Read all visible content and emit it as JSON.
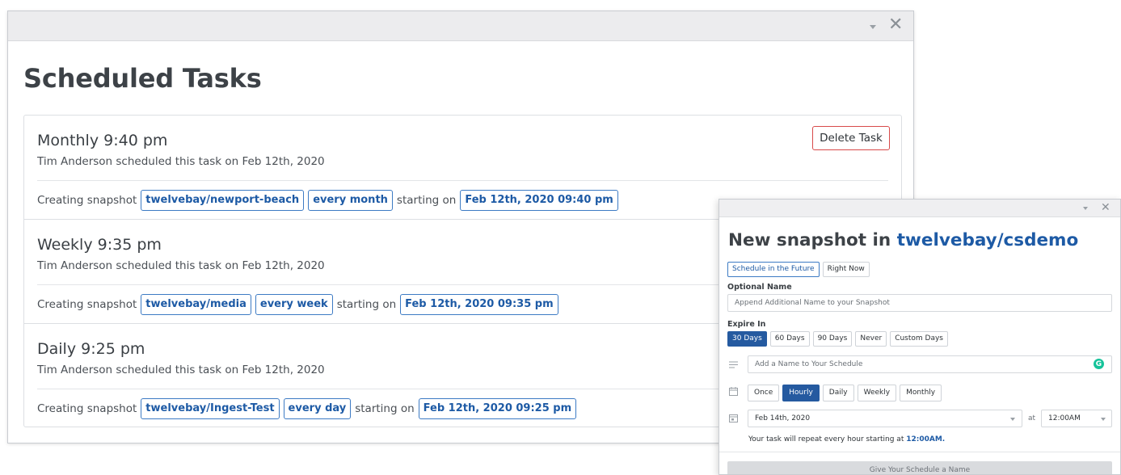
{
  "main_window": {
    "title": "Scheduled Tasks",
    "close_label": "✕",
    "delete_label": "Delete Task",
    "tasks": [
      {
        "title": "Monthly 9:40 pm",
        "scheduled_by": "Tim Anderson scheduled this task on Feb 12th, 2020",
        "prefix": "Creating snapshot",
        "repo": "twelvebay/newport-beach",
        "frequency": "every month",
        "starting_text": "starting on",
        "start": "Feb 12th, 2020 09:40 pm"
      },
      {
        "title": "Weekly 9:35 pm",
        "scheduled_by": "Tim Anderson scheduled this task on Feb 12th, 2020",
        "prefix": "Creating snapshot",
        "repo": "twelvebay/media",
        "frequency": "every week",
        "starting_text": "starting on",
        "start": "Feb 12th, 2020 09:35 pm"
      },
      {
        "title": "Daily 9:25 pm",
        "scheduled_by": "Tim Anderson scheduled this task on Feb 12th, 2020",
        "prefix": "Creating snapshot",
        "repo": "twelvebay/Ingest-Test",
        "frequency": "every day",
        "starting_text": "starting on",
        "start": "Feb 12th, 2020 09:25 pm"
      }
    ]
  },
  "snapshot_dialog": {
    "title_prefix": "New snapshot in",
    "repo": "twelvebay/csdemo",
    "close_label": "✕",
    "mode_tabs": [
      "Schedule in the Future",
      "Right Now"
    ],
    "optional_name_label": "Optional Name",
    "optional_name_placeholder": "Append Additional Name to your Snapshot",
    "expire_label": "Expire In",
    "expire_options": [
      "30 Days",
      "60 Days",
      "90 Days",
      "Never",
      "Custom Days"
    ],
    "schedule_name_placeholder": "Add a Name to Your Schedule",
    "grammarly_letter": "G",
    "frequency_options": [
      "Once",
      "Hourly",
      "Daily",
      "Weekly",
      "Monthly"
    ],
    "date_value": "Feb 14th, 2020",
    "at_label": "at",
    "time_value": "12:00AM",
    "note_prefix": "Your task will repeat every hour starting at",
    "note_time": "12:00AM.",
    "submit_label": "Give Your Schedule a Name",
    "colors": {
      "accent": "#255aa0",
      "link": "#1d5aa5",
      "danger": "#d84a4a",
      "grammarly": "#15c39a"
    }
  }
}
